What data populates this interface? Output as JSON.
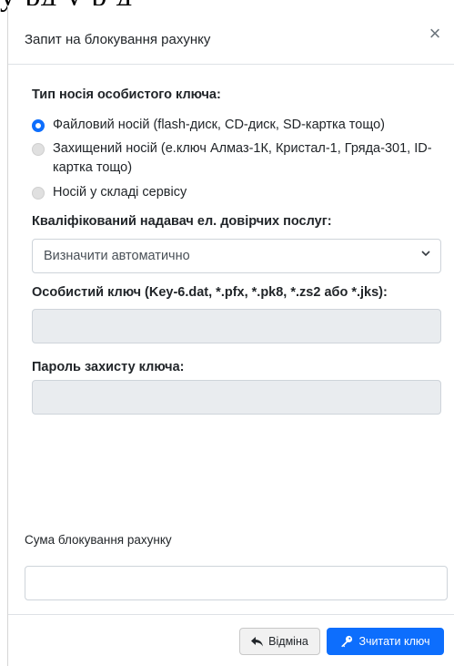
{
  "background": {
    "text": "у  рд   у р д"
  },
  "modal": {
    "title": "Запит на блокування рахунку",
    "close_label": "×"
  },
  "key_carrier": {
    "label": "Тип носія особистого ключа:",
    "options": [
      {
        "label": "Файловий носій (flash-диск, CD-диск, SD-картка тощо)",
        "checked": true
      },
      {
        "label": "Захищений носій (е.ключ Алмаз-1К, Кристал-1, Гряда-301, ID-картка тощо)",
        "checked": false
      },
      {
        "label": "Носій у складі сервісу",
        "checked": false
      }
    ]
  },
  "provider": {
    "label": "Кваліфікований надавач ел. довірчих послуг:",
    "selected": "Визначити автоматично"
  },
  "private_key": {
    "label": "Особистий ключ (Key-6.dat, *.pfx, *.pk8, *.zs2 або *.jks):"
  },
  "password": {
    "label": "Пароль захисту ключа:"
  },
  "block_amount": {
    "label": "Сума блокування рахунку",
    "value": ""
  },
  "footer": {
    "cancel_label": "Відміна",
    "read_key_label": "Зчитати ключ"
  },
  "colors": {
    "accent": "#0d6efd",
    "disabled_field": "#e9ecef"
  }
}
